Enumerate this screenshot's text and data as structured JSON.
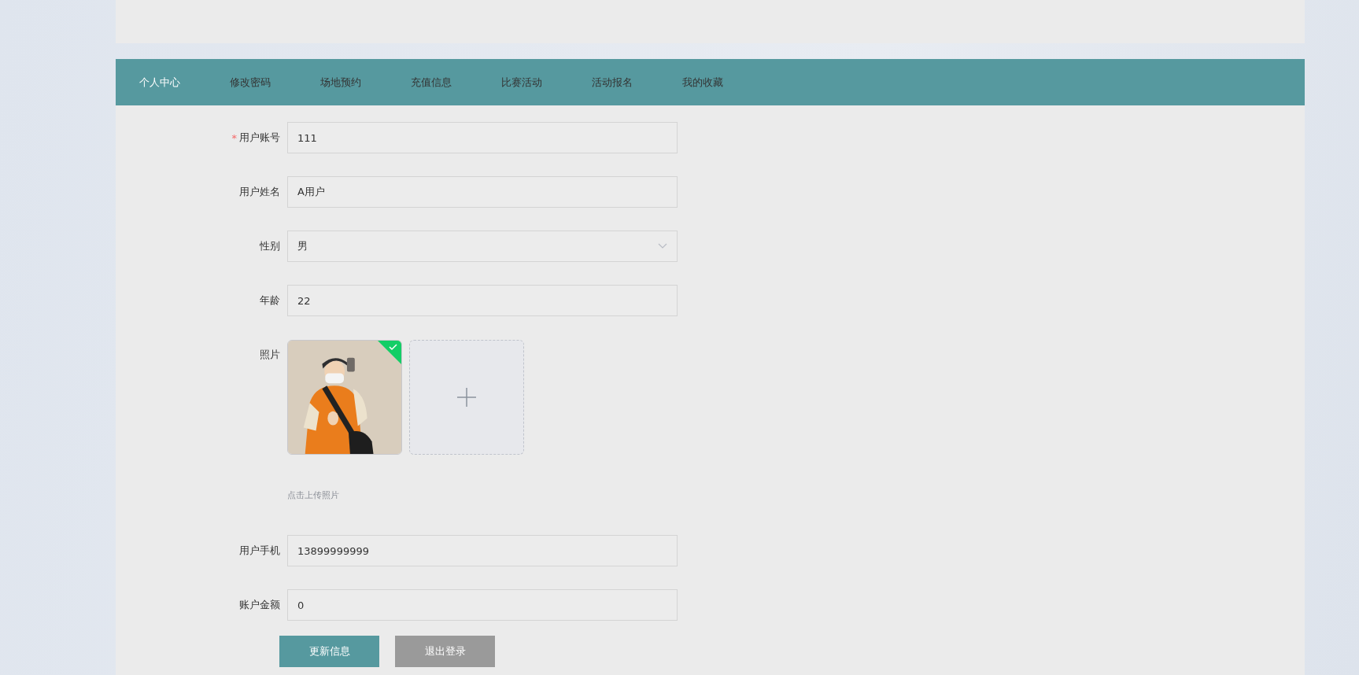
{
  "nav": {
    "items": [
      {
        "label": "个人中心",
        "selected": true
      },
      {
        "label": "修改密码",
        "selected": false
      },
      {
        "label": "场地预约",
        "selected": false
      },
      {
        "label": "充值信息",
        "selected": false
      },
      {
        "label": "比赛活动",
        "selected": false
      },
      {
        "label": "活动报名",
        "selected": false
      },
      {
        "label": "我的收藏",
        "selected": false
      }
    ]
  },
  "form": {
    "fields": [
      {
        "kind": "text",
        "label": "用户账号",
        "required_mark": "*",
        "value": "111"
      },
      {
        "kind": "text",
        "label": "用户姓名",
        "value": "A用户"
      },
      {
        "kind": "select",
        "label": "性别",
        "value": "男"
      },
      {
        "kind": "text",
        "label": "年龄",
        "value": "22"
      },
      {
        "label": "照片",
        "uploaded": true,
        "hint": "点击上传照片"
      },
      {
        "kind": "text",
        "label": "用户手机",
        "value": "13899999999"
      },
      {
        "kind": "text",
        "label": "账户金额",
        "value": "0"
      }
    ],
    "buttons": [
      {
        "label": "更新信息",
        "kind": "primary"
      },
      {
        "label": "退出登录",
        "kind": "secondary"
      }
    ]
  }
}
